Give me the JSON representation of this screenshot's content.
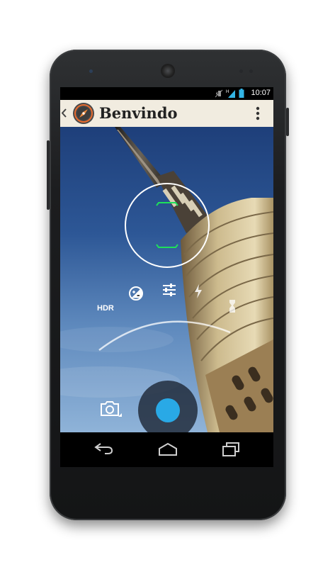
{
  "status_bar": {
    "time": "10:07",
    "icons": [
      "vibrate-icon",
      "signal-icon",
      "battery-icon"
    ]
  },
  "action_bar": {
    "app_title": "Benvindo",
    "icons": [
      "back-chevron-icon",
      "compass-app-icon",
      "overflow-menu-icon"
    ]
  },
  "camera": {
    "hdr_label": "HDR",
    "settings_icons": [
      "exposure-icon",
      "sliders-icon",
      "flash-icon",
      "timer-icon"
    ],
    "mode_icon": "camera-mode-icon",
    "shutter_icon": "shutter-icon",
    "focus_ring_icon": "focus-ring-icon"
  },
  "nav_bar": {
    "icons": [
      "back-icon",
      "home-icon",
      "recents-icon"
    ]
  },
  "colors": {
    "action_bar_bg": "#f1ece0",
    "shutter_blue": "#29a9e6",
    "focus_green": "#1ee05a",
    "status_blue": "#33b5e5"
  }
}
